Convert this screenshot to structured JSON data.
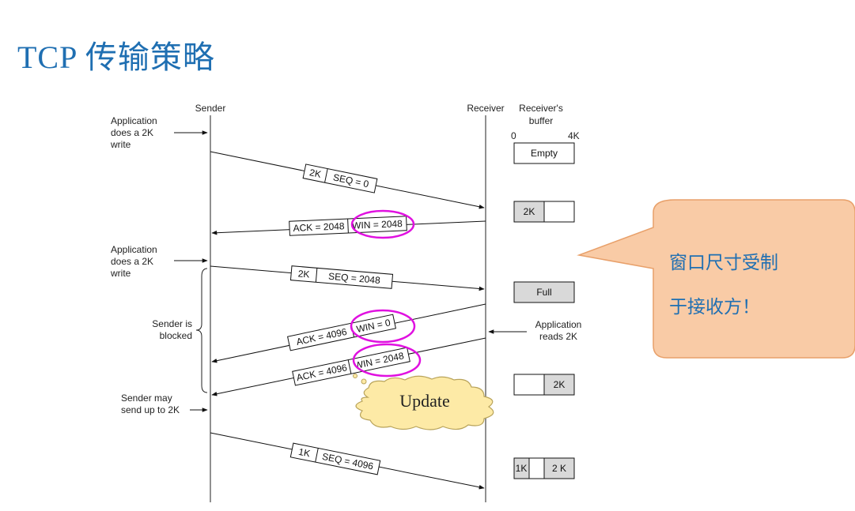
{
  "title": "TCP 传输策略",
  "headers": {
    "sender": "Sender",
    "receiver": "Receiver",
    "buffer_title": [
      "Receiver's",
      "buffer"
    ],
    "buffer_scale_0": "0",
    "buffer_scale_4k": "4K"
  },
  "left_notes": {
    "app_write_1": [
      "Application",
      "does a 2K",
      "write"
    ],
    "app_write_2": [
      "Application",
      "does a 2K",
      "write"
    ],
    "blocked": [
      "Sender is",
      "blocked"
    ],
    "may_send": [
      "Sender may",
      "send up to 2K"
    ]
  },
  "right_notes": {
    "app_reads": [
      "Application",
      "reads 2K"
    ]
  },
  "messages": {
    "m1": {
      "len": "2K",
      "seq": "SEQ = 0"
    },
    "m2": {
      "ack": "ACK = 2048",
      "win": "WIN = 2048"
    },
    "m3": {
      "len": "2K",
      "seq": "SEQ = 2048"
    },
    "m4": {
      "ack": "ACK = 4096",
      "win": "WIN = 0"
    },
    "m5": {
      "ack": "ACK = 4096",
      "win": "WIN = 2048"
    },
    "m6": {
      "len": "1K",
      "seq": "SEQ = 4096"
    }
  },
  "buffers": {
    "b1": "Empty",
    "b2": "2K",
    "b3": "Full",
    "b4": "2K",
    "b5_left": "1K",
    "b5_right": "2 K"
  },
  "cloud_label": "Update",
  "callout": {
    "line1": "窗口尺寸受制",
    "line2": "于接收方！"
  },
  "colors": {
    "title": "#1f6fb2",
    "highlight_ellipse": "#e010e0",
    "callout_fill": "#f9cba6",
    "callout_stroke": "#e8a06a",
    "cloud_fill": "#fdeaa6",
    "buffer_fill": "#d9d9d9"
  }
}
